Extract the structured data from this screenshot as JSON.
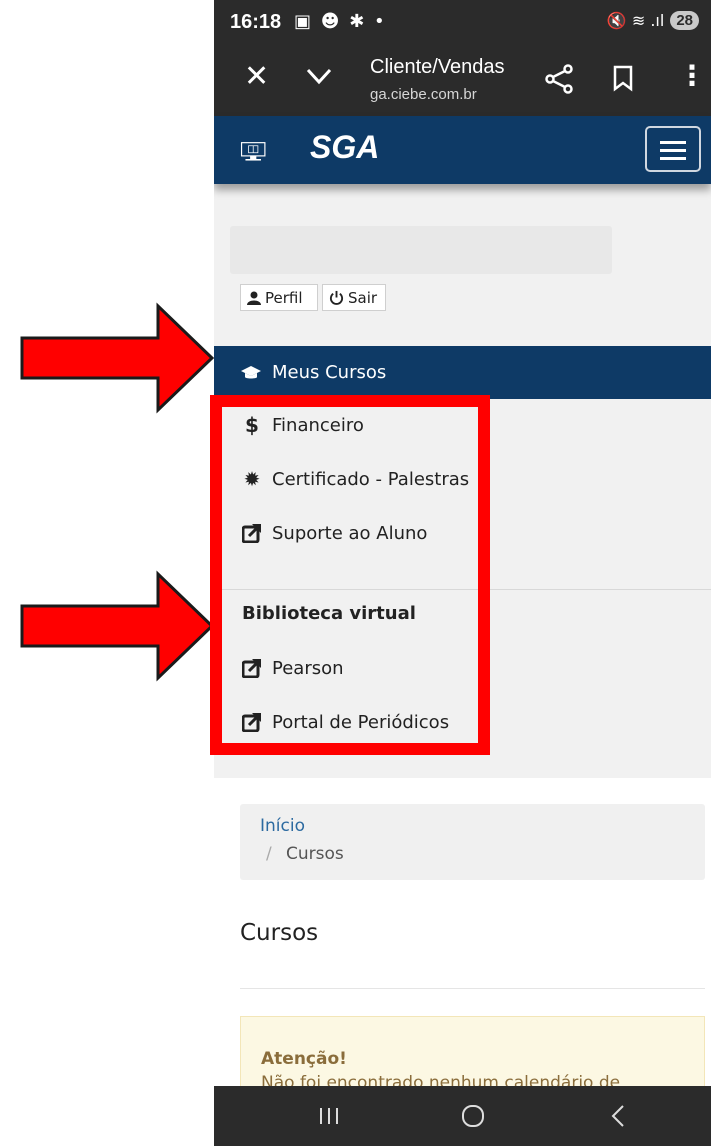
{
  "status_bar": {
    "time": "16:18",
    "notification_icons": "▣ ☻ ✱ •",
    "right_icons": "🔇 ≋ .ıl",
    "battery": "28"
  },
  "browser": {
    "page_title": "Cliente/Vendas",
    "url": "ga.ciebe.com.br",
    "close_glyph": "✕",
    "more_glyph": "⋮"
  },
  "navbar": {
    "logo_text": "SGA"
  },
  "user": {
    "profile_label": "Perfil",
    "logout_label": "Sair"
  },
  "menu": {
    "active": "Meus Cursos",
    "items": [
      {
        "label": "Financeiro",
        "icon": "dollar-icon",
        "glyph": "$"
      },
      {
        "label": "Certificado - Palestras",
        "icon": "certificate-icon",
        "glyph": "✹"
      },
      {
        "label": "Suporte ao Aluno",
        "icon": "external-link-icon"
      }
    ],
    "section_title": "Biblioteca virtual",
    "library_items": [
      {
        "label": "Pearson",
        "icon": "external-link-icon"
      },
      {
        "label": "Portal de Periódicos",
        "icon": "external-link-icon"
      }
    ]
  },
  "breadcrumb": {
    "home": "Início",
    "separator": "/",
    "current": "Cursos"
  },
  "page": {
    "title": "Cursos",
    "alert_heading": "Atenção!",
    "alert_message": "Não foi encontrado nenhum calendário de"
  },
  "colors": {
    "navbar": "#0e3a66",
    "annotation": "#ff0000",
    "browser_bar": "#2b2b2b"
  }
}
